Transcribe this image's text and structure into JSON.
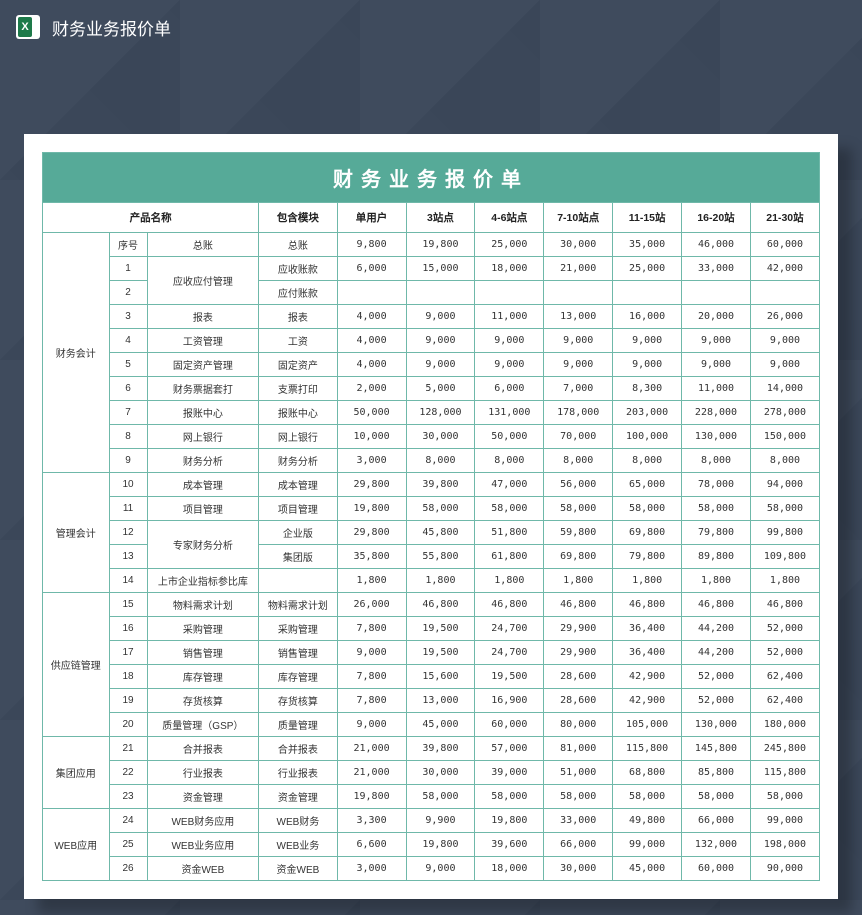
{
  "topbar": {
    "title": "财务业务报价单"
  },
  "sheet": {
    "title": "财务业务报价单",
    "headers": {
      "product_name": "产品名称",
      "seq": "序号",
      "module": "包含模块",
      "cols": [
        "单用户",
        "3站点",
        "4-6站点",
        "7-10站点",
        "11-15站",
        "16-20站",
        "21-30站"
      ]
    },
    "groups": [
      {
        "name": "财务会计",
        "rows": [
          {
            "seq": "",
            "name": "总账",
            "module": "总账",
            "vals": [
              "9,800",
              "19,800",
              "25,000",
              "30,000",
              "35,000",
              "46,000",
              "60,000"
            ],
            "seq_label": "序号"
          },
          {
            "seq": "1",
            "name": "应收应付管理",
            "module": "应收账款",
            "vals": [
              "6,000",
              "15,000",
              "18,000",
              "21,000",
              "25,000",
              "33,000",
              "42,000"
            ],
            "rowspan_name": 2
          },
          {
            "seq": "2",
            "name": "",
            "module": "应付账款",
            "vals": [
              "",
              "",
              "",
              "",
              "",
              "",
              ""
            ]
          },
          {
            "seq": "3",
            "name": "报表",
            "module": "报表",
            "vals": [
              "4,000",
              "9,000",
              "11,000",
              "13,000",
              "16,000",
              "20,000",
              "26,000"
            ]
          },
          {
            "seq": "4",
            "name": "工资管理",
            "module": "工资",
            "vals": [
              "4,000",
              "9,000",
              "9,000",
              "9,000",
              "9,000",
              "9,000",
              "9,000"
            ]
          },
          {
            "seq": "5",
            "name": "固定资产管理",
            "module": "固定资产",
            "vals": [
              "4,000",
              "9,000",
              "9,000",
              "9,000",
              "9,000",
              "9,000",
              "9,000"
            ]
          },
          {
            "seq": "6",
            "name": "财务票据套打",
            "module": "支票打印",
            "vals": [
              "2,000",
              "5,000",
              "6,000",
              "7,000",
              "8,300",
              "11,000",
              "14,000"
            ]
          },
          {
            "seq": "7",
            "name": "报账中心",
            "module": "报账中心",
            "vals": [
              "50,000",
              "128,000",
              "131,000",
              "178,000",
              "203,000",
              "228,000",
              "278,000"
            ]
          },
          {
            "seq": "8",
            "name": "网上银行",
            "module": "网上银行",
            "vals": [
              "10,000",
              "30,000",
              "50,000",
              "70,000",
              "100,000",
              "130,000",
              "150,000"
            ]
          },
          {
            "seq": "9",
            "name": "财务分析",
            "module": "财务分析",
            "vals": [
              "3,000",
              "8,000",
              "8,000",
              "8,000",
              "8,000",
              "8,000",
              "8,000"
            ]
          }
        ]
      },
      {
        "name": "管理会计",
        "rows": [
          {
            "seq": "10",
            "name": "成本管理",
            "module": "成本管理",
            "vals": [
              "29,800",
              "39,800",
              "47,000",
              "56,000",
              "65,000",
              "78,000",
              "94,000"
            ]
          },
          {
            "seq": "11",
            "name": "项目管理",
            "module": "项目管理",
            "vals": [
              "19,800",
              "58,000",
              "58,000",
              "58,000",
              "58,000",
              "58,000",
              "58,000"
            ]
          },
          {
            "seq": "12",
            "name": "专家财务分析",
            "module": "企业版",
            "vals": [
              "29,800",
              "45,800",
              "51,800",
              "59,800",
              "69,800",
              "79,800",
              "99,800"
            ],
            "rowspan_name": 2
          },
          {
            "seq": "13",
            "name": "",
            "module": "集团版",
            "vals": [
              "35,800",
              "55,800",
              "61,800",
              "69,800",
              "79,800",
              "89,800",
              "109,800"
            ]
          },
          {
            "seq": "14",
            "name": "上市企业指标参比库",
            "module": "",
            "vals": [
              "1,800",
              "1,800",
              "1,800",
              "1,800",
              "1,800",
              "1,800",
              "1,800"
            ]
          }
        ]
      },
      {
        "name": "供应链管理",
        "rows": [
          {
            "seq": "15",
            "name": "物料需求计划",
            "module": "物料需求计划",
            "vals": [
              "26,000",
              "46,800",
              "46,800",
              "46,800",
              "46,800",
              "46,800",
              "46,800"
            ]
          },
          {
            "seq": "16",
            "name": "采购管理",
            "module": "采购管理",
            "vals": [
              "7,800",
              "19,500",
              "24,700",
              "29,900",
              "36,400",
              "44,200",
              "52,000"
            ]
          },
          {
            "seq": "17",
            "name": "销售管理",
            "module": "销售管理",
            "vals": [
              "9,000",
              "19,500",
              "24,700",
              "29,900",
              "36,400",
              "44,200",
              "52,000"
            ]
          },
          {
            "seq": "18",
            "name": "库存管理",
            "module": "库存管理",
            "vals": [
              "7,800",
              "15,600",
              "19,500",
              "28,600",
              "42,900",
              "52,000",
              "62,400"
            ]
          },
          {
            "seq": "19",
            "name": "存货核算",
            "module": "存货核算",
            "vals": [
              "7,800",
              "13,000",
              "16,900",
              "28,600",
              "42,900",
              "52,000",
              "62,400"
            ]
          },
          {
            "seq": "20",
            "name": "质量管理（GSP）",
            "module": "质量管理",
            "vals": [
              "9,000",
              "45,000",
              "60,000",
              "80,000",
              "105,000",
              "130,000",
              "180,000"
            ]
          }
        ]
      },
      {
        "name": "集团应用",
        "rows": [
          {
            "seq": "21",
            "name": "合并报表",
            "module": "合并报表",
            "vals": [
              "21,000",
              "39,800",
              "57,000",
              "81,000",
              "115,800",
              "145,800",
              "245,800"
            ]
          },
          {
            "seq": "22",
            "name": "行业报表",
            "module": "行业报表",
            "vals": [
              "21,000",
              "30,000",
              "39,000",
              "51,000",
              "68,800",
              "85,800",
              "115,800"
            ]
          },
          {
            "seq": "23",
            "name": "资金管理",
            "module": "资金管理",
            "vals": [
              "19,800",
              "58,000",
              "58,000",
              "58,000",
              "58,000",
              "58,000",
              "58,000"
            ]
          }
        ]
      },
      {
        "name": "WEB应用",
        "rows": [
          {
            "seq": "24",
            "name": "WEB财务应用",
            "module": "WEB财务",
            "vals": [
              "3,300",
              "9,900",
              "19,800",
              "33,000",
              "49,800",
              "66,000",
              "99,000"
            ]
          },
          {
            "seq": "25",
            "name": "WEB业务应用",
            "module": "WEB业务",
            "vals": [
              "6,600",
              "19,800",
              "39,600",
              "66,000",
              "99,000",
              "132,000",
              "198,000"
            ]
          },
          {
            "seq": "26",
            "name": "资金WEB",
            "module": "资金WEB",
            "vals": [
              "3,000",
              "9,000",
              "18,000",
              "30,000",
              "45,000",
              "60,000",
              "90,000"
            ]
          }
        ]
      }
    ]
  }
}
